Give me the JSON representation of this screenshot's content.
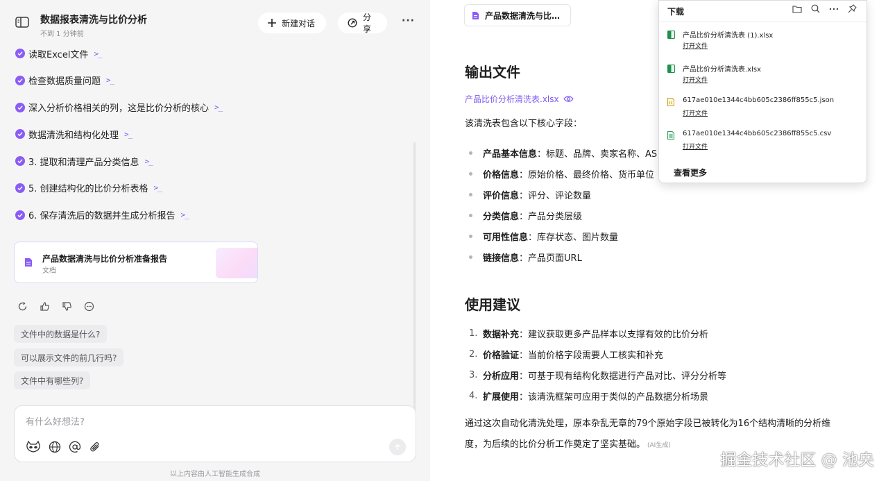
{
  "left": {
    "title": "数据报表清洗与比价分析",
    "time": "不到 1 分钟前",
    "new_chat_label": "新建对话",
    "share_label": "分享",
    "more_label": "···",
    "steps": [
      "读取Excel文件",
      "检查数据质量问题",
      "深入分析价格相关的列，这是比价分析的核心",
      "数据清洗和结构化处理",
      "3. 提取和清理产品分类信息",
      "5. 创建结构化的比价分析表格",
      "6. 保存清洗后的数据并生成分析报告"
    ],
    "doc_card": {
      "title": "产品数据清洗与比价分析准备报告",
      "subtitle": "文档"
    },
    "suggestions": [
      "文件中的数据是什么?",
      "可以展示文件的前几行吗?",
      "文件中有哪些列?"
    ],
    "input_placeholder": "有什么好想法?",
    "footnote": "以上内容由人工智能生成合成"
  },
  "right": {
    "file_tab": "产品数据清洗与比…",
    "section1_title": "输出文件",
    "xlsx_link": "产品比价分析清洗表.xlsx",
    "intro": "该清洗表包含以下核心字段：",
    "fields": [
      {
        "label": "产品基本信息",
        "value": "：标题、品牌、卖家名称、AS"
      },
      {
        "label": "价格信息",
        "value": "：原始价格、最终价格、货币单位"
      },
      {
        "label": "评价信息",
        "value": "：评分、评论数量"
      },
      {
        "label": "分类信息",
        "value": "：产品分类层级"
      },
      {
        "label": "可用性信息",
        "value": "：库存状态、图片数量"
      },
      {
        "label": "链接信息",
        "value": "：产品页面URL"
      }
    ],
    "section2_title": "使用建议",
    "suggestions": [
      {
        "num": "1.",
        "label": "数据补充",
        "value": "：建议获取更多产品样本以支撑有效的比价分析"
      },
      {
        "num": "2.",
        "label": "价格验证",
        "value": "：当前价格字段需要人工核实和补充"
      },
      {
        "num": "3.",
        "label": "分析应用",
        "value": "：可基于现有结构化数据进行产品对比、评分分析等"
      },
      {
        "num": "4.",
        "label": "扩展使用",
        "value": "：该清洗框架可应用于类似的产品数据分析场景"
      }
    ],
    "conclusion_line1": "通过这次自动化清洗处理，原本杂乱无章的79个原始字段已被转化为16个结构清晰的分析维",
    "conclusion_line2": "度，为后续的比价分析工作奠定了坚实基础。",
    "ai_tag": "(AI生成)",
    "watermark": "掘金技术社区 @ 池央"
  },
  "downloads": {
    "title": "下载",
    "items": [
      {
        "name": "产品比价分析清洗表 (1).xlsx",
        "action": "打开文件",
        "type": "xlsx"
      },
      {
        "name": "产品比价分析清洗表.xlsx",
        "action": "打开文件",
        "type": "xlsx"
      },
      {
        "name": "617ae010e1344c4bb605c2386ff855c5.json",
        "action": "打开文件",
        "type": "json"
      },
      {
        "name": "617ae010e1344c4bb605c2386ff855c5.csv",
        "action": "打开文件",
        "type": "csv"
      }
    ],
    "see_more": "查看更多"
  },
  "colors": {
    "accent": "#8b5cf6",
    "link": "#7c5cf0",
    "excel_green": "#1f8f4e"
  }
}
